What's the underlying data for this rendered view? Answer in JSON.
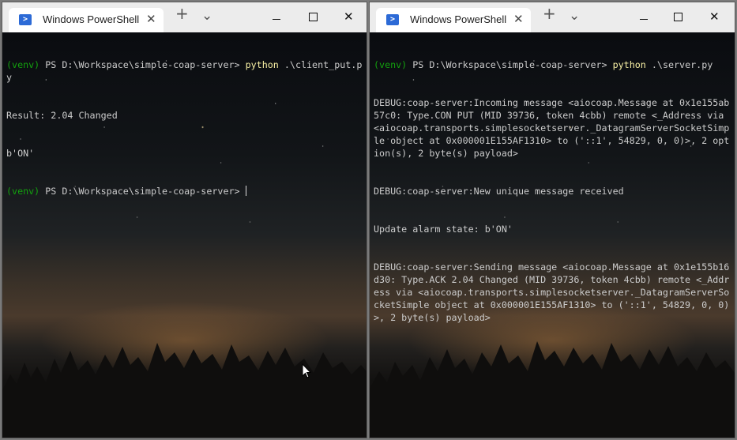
{
  "windows": [
    {
      "tab_title": "Windows PowerShell",
      "icon": "powershell-icon",
      "tab_close": "✕",
      "new_tab": "+",
      "dropdown": "⌄",
      "lines": [
        {
          "venv": "(venv)",
          "prompt": " PS D:\\Workspace\\simple-coap-server> ",
          "cmd": "python",
          "args": " .\\client_put.py"
        },
        {
          "text": "Result: 2.04 Changed"
        },
        {
          "text": "b'ON'"
        },
        {
          "venv": "(venv)",
          "prompt": " PS D:\\Workspace\\simple-coap-server> ",
          "cmd": "",
          "args": "",
          "cursor": true
        }
      ]
    },
    {
      "tab_title": "Windows PowerShell",
      "icon": "powershell-icon",
      "tab_close": "✕",
      "new_tab": "+",
      "dropdown": "⌄",
      "lines": [
        {
          "venv": "(venv)",
          "prompt": " PS D:\\Workspace\\simple-coap-server> ",
          "cmd": "python",
          "args": " .\\server.py"
        },
        {
          "text": "DEBUG:coap-server:Incoming message <aiocoap.Message at 0x1e155ab57c0: Type.CON PUT (MID 39736, token 4cbb) remote <_Address via <aiocoap.transports.simplesocketserver._DatagramServerSocketSimple object at 0x000001E155AF1310> to ('::1', 54829, 0, 0)>, 2 option(s), 2 byte(s) payload>"
        },
        {
          "text": "DEBUG:coap-server:New unique message received"
        },
        {
          "text": "Update alarm state: b'ON'"
        },
        {
          "text": "DEBUG:coap-server:Sending message <aiocoap.Message at 0x1e155b16d30: Type.ACK 2.04 Changed (MID 39736, token 4cbb) remote <_Address via <aiocoap.transports.simplesocketserver._DatagramServerSocketSimple object at 0x000001E155AF1310> to ('::1', 54829, 0, 0)>, 2 byte(s) payload>"
        }
      ]
    }
  ],
  "window_controls": {
    "minimize": "minimize-icon",
    "maximize": "maximize-icon",
    "close": "✕"
  },
  "colors": {
    "venv": "#13a10e",
    "command": "#f9f1a5",
    "text": "#cccccc",
    "ps_icon": "#2c6ad6"
  }
}
